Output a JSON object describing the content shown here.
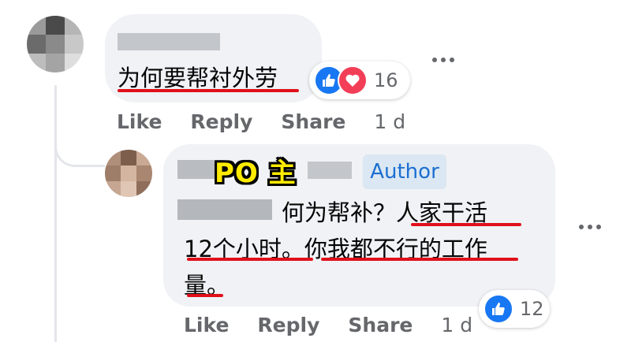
{
  "comment1": {
    "text": "为何要帮衬外劳",
    "reactions": {
      "icons": [
        "like-icon",
        "love-icon"
      ],
      "count": "16"
    },
    "actions": {
      "like": "Like",
      "reply": "Reply",
      "share": "Share",
      "time": "1 d"
    }
  },
  "comment2": {
    "overlay_label": "PO 主",
    "badge": "Author",
    "text_line1": "何为帮补？人家干活",
    "text_line2": "12个小时。你我都不行的工作",
    "text_line3": "量。",
    "reactions": {
      "icons": [
        "like-icon"
      ],
      "count": "12"
    },
    "actions": {
      "like": "Like",
      "reply": "Reply",
      "share": "Share",
      "time": "1 d"
    }
  },
  "colors": {
    "bubble": "#f0f2f5",
    "highlight_underline": "#e0101a",
    "author_badge_bg": "#dbe7f2",
    "author_badge_text": "#1c6fd1",
    "like_blue": "#1877f2",
    "love_red": "#f33e58",
    "po_label": "#ffeb00"
  }
}
